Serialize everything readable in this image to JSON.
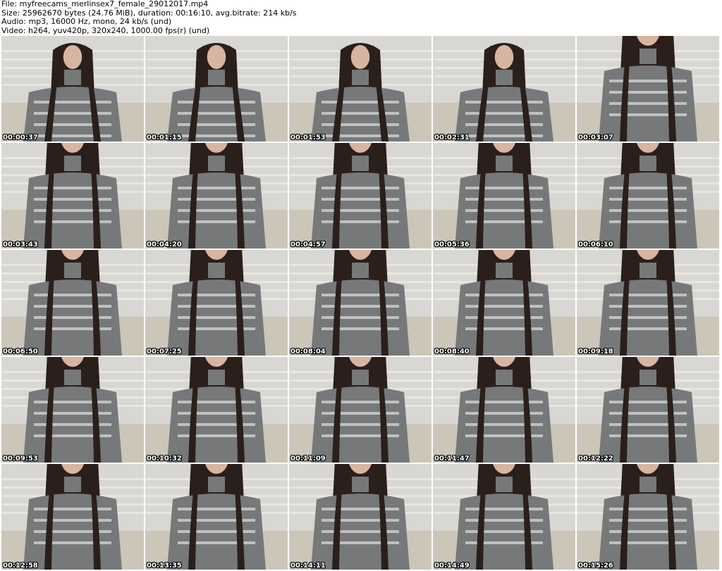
{
  "header": {
    "file_line": "File: myfreecams_merlinsex7_female_29012017.mp4",
    "size_line": "Size: 25962670 bytes (24.76 MiB), duration: 00:16:10, avg.bitrate: 214 kb/s",
    "audio_line": "Audio: mp3, 16000 Hz, mono, 24 kb/s (und)",
    "video_line": "Video: h264, yuv420p, 320x240, 1000.00 fps(r) (und)"
  },
  "thumbnails": [
    {
      "timestamp": "00:00:37",
      "variant": "wide"
    },
    {
      "timestamp": "00:01:15",
      "variant": "wide"
    },
    {
      "timestamp": "00:01:53",
      "variant": "wide"
    },
    {
      "timestamp": "00:02:31",
      "variant": "wide"
    },
    {
      "timestamp": "00:03:07",
      "variant": "close"
    },
    {
      "timestamp": "00:03:43",
      "variant": "close"
    },
    {
      "timestamp": "00:04:20",
      "variant": "close"
    },
    {
      "timestamp": "00:04:57",
      "variant": "close"
    },
    {
      "timestamp": "00:05:36",
      "variant": "close"
    },
    {
      "timestamp": "00:06:10",
      "variant": "close"
    },
    {
      "timestamp": "00:06:50",
      "variant": "close"
    },
    {
      "timestamp": "00:07:25",
      "variant": "close"
    },
    {
      "timestamp": "00:08:04",
      "variant": "close"
    },
    {
      "timestamp": "00:08:40",
      "variant": "close"
    },
    {
      "timestamp": "00:09:18",
      "variant": "close"
    },
    {
      "timestamp": "00:09:53",
      "variant": "close"
    },
    {
      "timestamp": "00:10:32",
      "variant": "close"
    },
    {
      "timestamp": "00:11:09",
      "variant": "close"
    },
    {
      "timestamp": "00:11:47",
      "variant": "close"
    },
    {
      "timestamp": "00:12:22",
      "variant": "close"
    },
    {
      "timestamp": "00:12:58",
      "variant": "close"
    },
    {
      "timestamp": "00:13:35",
      "variant": "close"
    },
    {
      "timestamp": "00:14:11",
      "variant": "close"
    },
    {
      "timestamp": "00:14:49",
      "variant": "close"
    },
    {
      "timestamp": "00:15:26",
      "variant": "close"
    }
  ],
  "colors": {
    "wall": "#d9d7d3",
    "bed": "#cbc6b8",
    "hair": "#2a1f1a",
    "skin": "#d9b4a0",
    "sweater": "#77787a",
    "pattern": "#d8d8d8",
    "timestamp_text": "#ffffff",
    "timestamp_outline": "#000000"
  }
}
